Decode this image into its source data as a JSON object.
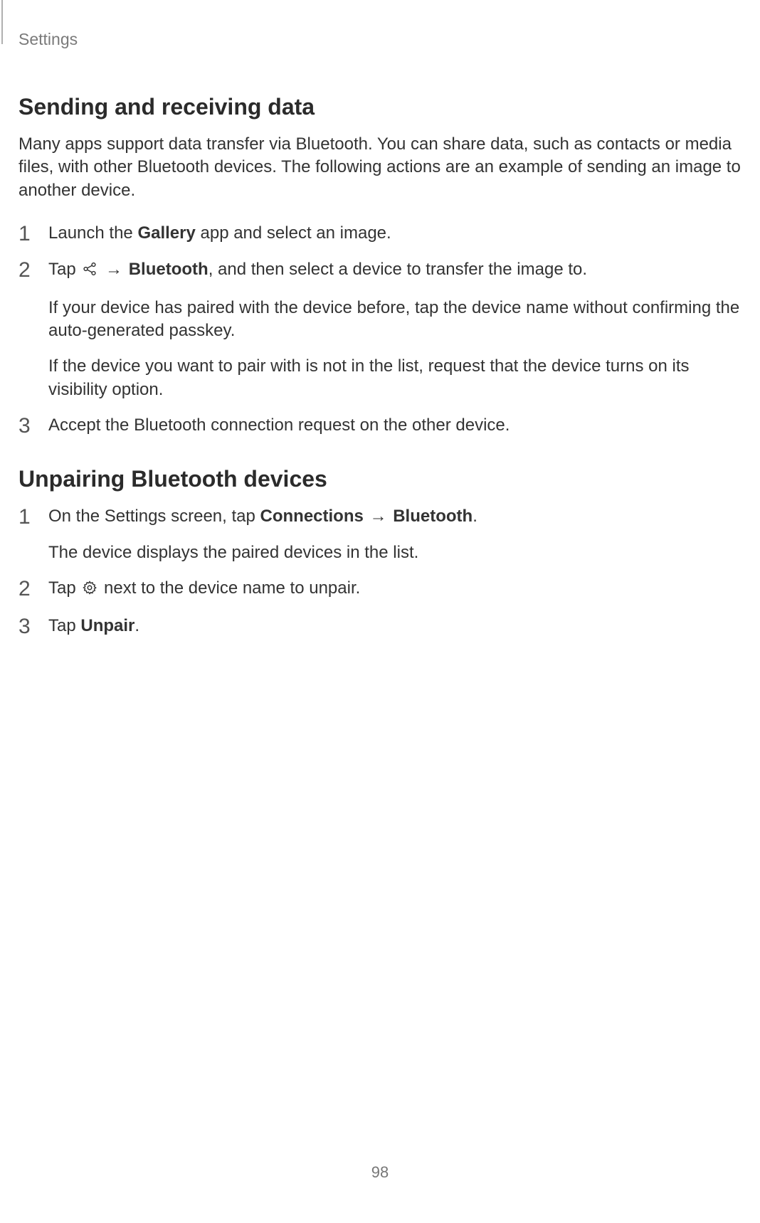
{
  "header": {
    "label": "Settings"
  },
  "section1": {
    "title": "Sending and receiving data",
    "intro": "Many apps support data transfer via Bluetooth. You can share data, such as contacts or media files, with other Bluetooth devices. The following actions are an example of sending an image to another device.",
    "steps": [
      {
        "num": "1",
        "line1_a": "Launch the ",
        "line1_b": "Gallery",
        "line1_c": " app and select an image."
      },
      {
        "num": "2",
        "line1_a": "Tap ",
        "arrow": " → ",
        "line1_b": "Bluetooth",
        "line1_c": ", and then select a device to transfer the image to.",
        "line2": "If your device has paired with the device before, tap the device name without confirming the auto-generated passkey.",
        "line3": "If the device you want to pair with is not in the list, request that the device turns on its visibility option."
      },
      {
        "num": "3",
        "line1": "Accept the Bluetooth connection request on the other device."
      }
    ]
  },
  "section2": {
    "title": "Unpairing Bluetooth devices",
    "steps": [
      {
        "num": "1",
        "line1_a": "On the Settings screen, tap ",
        "line1_b": "Connections",
        "arrow": " → ",
        "line1_c": "Bluetooth",
        "line1_d": ".",
        "line2": "The device displays the paired devices in the list."
      },
      {
        "num": "2",
        "line1_a": "Tap ",
        "line1_b": " next to the device name to unpair."
      },
      {
        "num": "3",
        "line1_a": "Tap ",
        "line1_b": "Unpair",
        "line1_c": "."
      }
    ]
  },
  "pageNumber": "98"
}
